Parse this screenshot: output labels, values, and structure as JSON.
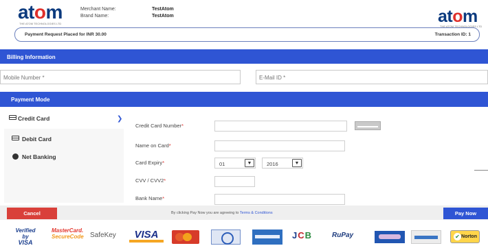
{
  "header": {
    "logo_text_a": "at",
    "logo_text_o": "o",
    "logo_text_m": "m",
    "tagline": "THE ATOM TECHNOLOGIES LTD",
    "merchant_label": "Merchant Name:",
    "merchant_value": "TestAtom",
    "brand_label": "Brand Name:",
    "brand_value": "TestAtom",
    "request_text": "Payment Request Placed for INR 30.00",
    "transaction_text": "Transaction ID: 1"
  },
  "billing": {
    "title": "Billing Information",
    "mobile_placeholder": "Mobile Number *",
    "email_placeholder": "E-Mail ID *"
  },
  "payment": {
    "title": "Payment Mode",
    "tabs": [
      {
        "label": "Credit Card",
        "active": true
      },
      {
        "label": "Debit Card",
        "active": false
      },
      {
        "label": "Net Banking",
        "active": false
      }
    ],
    "fields": {
      "card_number_label": "Credit Card Number",
      "name_label": "Name on Card",
      "expiry_label": "Card Expiry",
      "cvv_label": "CVV / CVV2",
      "bank_label": "Bank Name",
      "required_mark": "*"
    },
    "expiry": {
      "month": "01",
      "year": "2016"
    }
  },
  "actions": {
    "cancel_label": "Cancel",
    "terms_prefix": "By clicking Pay Now you are agreeing to",
    "terms_link": "Terms & Conditions",
    "pay_label": "Pay Now"
  },
  "trust": {
    "vbv_line1": "Verified by",
    "vbv_line2": "VISA",
    "msc_line1": "MasterCard.",
    "msc_line2": "SecureCode",
    "safekey": "SafeKey",
    "visa": "VISA",
    "rupay": "RuPay",
    "norton": "Norton"
  },
  "colors": {
    "brand_blue": "#2f55d4",
    "cancel_red": "#d9403a",
    "logo_navy": "#0b3a7e",
    "logo_red": "#e0312c"
  }
}
